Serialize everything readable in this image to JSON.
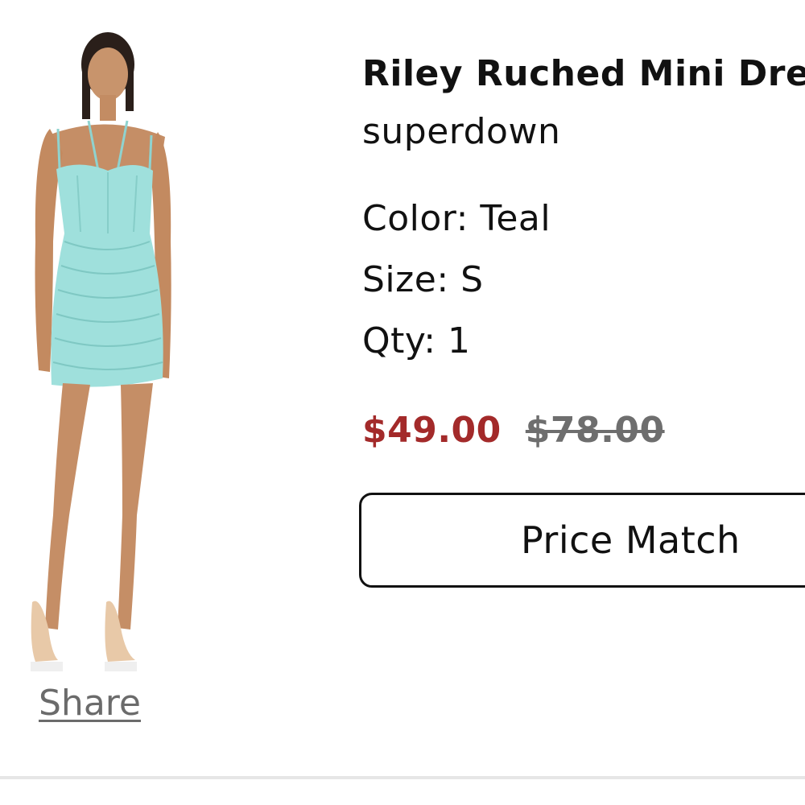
{
  "product": {
    "title": "Riley Ruched Mini Dress",
    "brand": "superdown",
    "color_text": "Color: Teal",
    "size_text": "Size: S",
    "qty_text": "Qty: 1",
    "sale_price": "$49.00",
    "original_price": "$78.00",
    "image_icon": "dress-photo"
  },
  "actions": {
    "share_label": "Share",
    "price_match_label": "Price Match"
  },
  "colors": {
    "sale_price": "#a32a2a",
    "original_price": "#6e6e6e",
    "dress": "#9fe0dc",
    "share": "#6b6b6b"
  }
}
